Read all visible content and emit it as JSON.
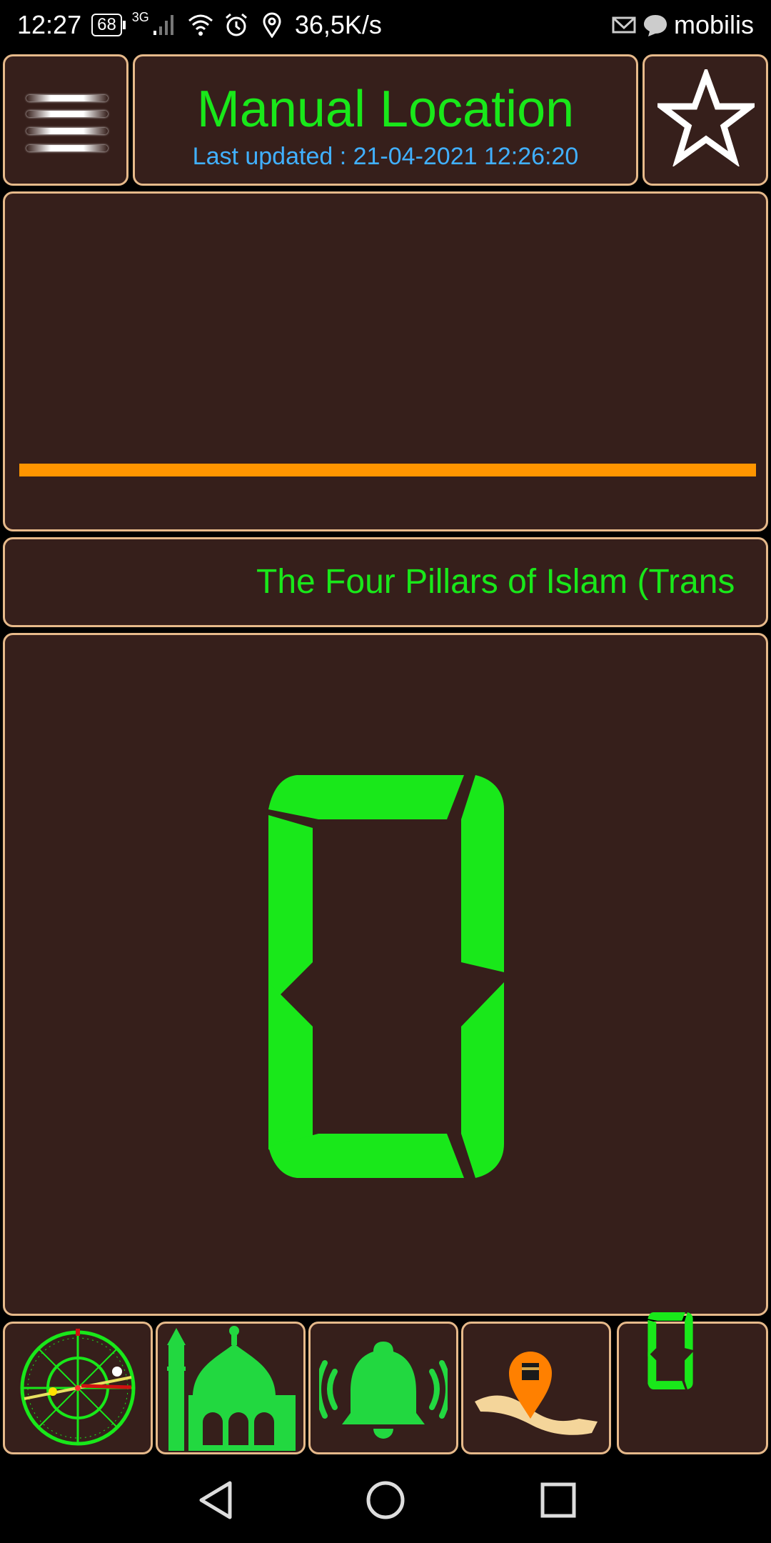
{
  "status_bar": {
    "time": "12:27",
    "battery": "68",
    "network": "3G",
    "speed": "36,5K/s",
    "carrier": "mobilis"
  },
  "header": {
    "title": "Manual Location",
    "subtitle": "Last updated : 21-04-2021 12:26:20"
  },
  "ad_panel": {
    "progress_percent": 100,
    "progress_color": "#ff9500"
  },
  "ticker": {
    "text": "The Four Pillars of Islam (Trans"
  },
  "counter": {
    "value": "0",
    "color": "#19e81a"
  },
  "bottom_nav": [
    {
      "icon": "qibla-compass-icon"
    },
    {
      "icon": "mosque-icon"
    },
    {
      "icon": "adhan-bell-icon"
    },
    {
      "icon": "kaaba-location-pin-icon"
    },
    {
      "icon": "tasbih-counter-icon",
      "value": "0"
    }
  ],
  "colors": {
    "panel_bg": "#361f1b",
    "panel_border": "#e6b98a",
    "accent_green": "#19e81a",
    "subtitle_blue": "#41b0ff"
  }
}
